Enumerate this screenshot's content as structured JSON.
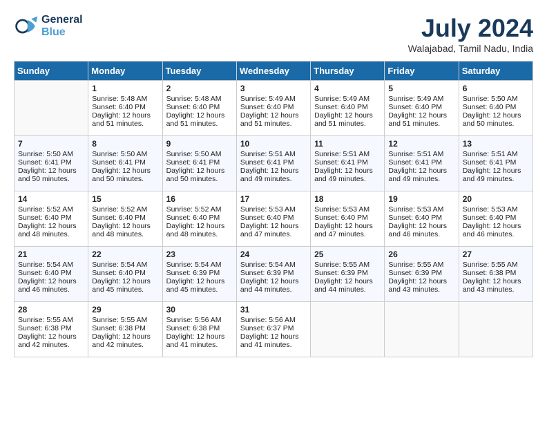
{
  "header": {
    "logo_line1": "General",
    "logo_line2": "Blue",
    "month_year": "July 2024",
    "location": "Walajabad, Tamil Nadu, India"
  },
  "days_of_week": [
    "Sunday",
    "Monday",
    "Tuesday",
    "Wednesday",
    "Thursday",
    "Friday",
    "Saturday"
  ],
  "weeks": [
    [
      {
        "day": "",
        "data": ""
      },
      {
        "day": "1",
        "data": "Sunrise: 5:48 AM\nSunset: 6:40 PM\nDaylight: 12 hours\nand 51 minutes."
      },
      {
        "day": "2",
        "data": "Sunrise: 5:48 AM\nSunset: 6:40 PM\nDaylight: 12 hours\nand 51 minutes."
      },
      {
        "day": "3",
        "data": "Sunrise: 5:49 AM\nSunset: 6:40 PM\nDaylight: 12 hours\nand 51 minutes."
      },
      {
        "day": "4",
        "data": "Sunrise: 5:49 AM\nSunset: 6:40 PM\nDaylight: 12 hours\nand 51 minutes."
      },
      {
        "day": "5",
        "data": "Sunrise: 5:49 AM\nSunset: 6:40 PM\nDaylight: 12 hours\nand 51 minutes."
      },
      {
        "day": "6",
        "data": "Sunrise: 5:50 AM\nSunset: 6:40 PM\nDaylight: 12 hours\nand 50 minutes."
      }
    ],
    [
      {
        "day": "7",
        "data": "Sunrise: 5:50 AM\nSunset: 6:41 PM\nDaylight: 12 hours\nand 50 minutes."
      },
      {
        "day": "8",
        "data": "Sunrise: 5:50 AM\nSunset: 6:41 PM\nDaylight: 12 hours\nand 50 minutes."
      },
      {
        "day": "9",
        "data": "Sunrise: 5:50 AM\nSunset: 6:41 PM\nDaylight: 12 hours\nand 50 minutes."
      },
      {
        "day": "10",
        "data": "Sunrise: 5:51 AM\nSunset: 6:41 PM\nDaylight: 12 hours\nand 49 minutes."
      },
      {
        "day": "11",
        "data": "Sunrise: 5:51 AM\nSunset: 6:41 PM\nDaylight: 12 hours\nand 49 minutes."
      },
      {
        "day": "12",
        "data": "Sunrise: 5:51 AM\nSunset: 6:41 PM\nDaylight: 12 hours\nand 49 minutes."
      },
      {
        "day": "13",
        "data": "Sunrise: 5:51 AM\nSunset: 6:41 PM\nDaylight: 12 hours\nand 49 minutes."
      }
    ],
    [
      {
        "day": "14",
        "data": "Sunrise: 5:52 AM\nSunset: 6:40 PM\nDaylight: 12 hours\nand 48 minutes."
      },
      {
        "day": "15",
        "data": "Sunrise: 5:52 AM\nSunset: 6:40 PM\nDaylight: 12 hours\nand 48 minutes."
      },
      {
        "day": "16",
        "data": "Sunrise: 5:52 AM\nSunset: 6:40 PM\nDaylight: 12 hours\nand 48 minutes."
      },
      {
        "day": "17",
        "data": "Sunrise: 5:53 AM\nSunset: 6:40 PM\nDaylight: 12 hours\nand 47 minutes."
      },
      {
        "day": "18",
        "data": "Sunrise: 5:53 AM\nSunset: 6:40 PM\nDaylight: 12 hours\nand 47 minutes."
      },
      {
        "day": "19",
        "data": "Sunrise: 5:53 AM\nSunset: 6:40 PM\nDaylight: 12 hours\nand 46 minutes."
      },
      {
        "day": "20",
        "data": "Sunrise: 5:53 AM\nSunset: 6:40 PM\nDaylight: 12 hours\nand 46 minutes."
      }
    ],
    [
      {
        "day": "21",
        "data": "Sunrise: 5:54 AM\nSunset: 6:40 PM\nDaylight: 12 hours\nand 46 minutes."
      },
      {
        "day": "22",
        "data": "Sunrise: 5:54 AM\nSunset: 6:40 PM\nDaylight: 12 hours\nand 45 minutes."
      },
      {
        "day": "23",
        "data": "Sunrise: 5:54 AM\nSunset: 6:39 PM\nDaylight: 12 hours\nand 45 minutes."
      },
      {
        "day": "24",
        "data": "Sunrise: 5:54 AM\nSunset: 6:39 PM\nDaylight: 12 hours\nand 44 minutes."
      },
      {
        "day": "25",
        "data": "Sunrise: 5:55 AM\nSunset: 6:39 PM\nDaylight: 12 hours\nand 44 minutes."
      },
      {
        "day": "26",
        "data": "Sunrise: 5:55 AM\nSunset: 6:39 PM\nDaylight: 12 hours\nand 43 minutes."
      },
      {
        "day": "27",
        "data": "Sunrise: 5:55 AM\nSunset: 6:38 PM\nDaylight: 12 hours\nand 43 minutes."
      }
    ],
    [
      {
        "day": "28",
        "data": "Sunrise: 5:55 AM\nSunset: 6:38 PM\nDaylight: 12 hours\nand 42 minutes."
      },
      {
        "day": "29",
        "data": "Sunrise: 5:55 AM\nSunset: 6:38 PM\nDaylight: 12 hours\nand 42 minutes."
      },
      {
        "day": "30",
        "data": "Sunrise: 5:56 AM\nSunset: 6:38 PM\nDaylight: 12 hours\nand 41 minutes."
      },
      {
        "day": "31",
        "data": "Sunrise: 5:56 AM\nSunset: 6:37 PM\nDaylight: 12 hours\nand 41 minutes."
      },
      {
        "day": "",
        "data": ""
      },
      {
        "day": "",
        "data": ""
      },
      {
        "day": "",
        "data": ""
      }
    ]
  ]
}
